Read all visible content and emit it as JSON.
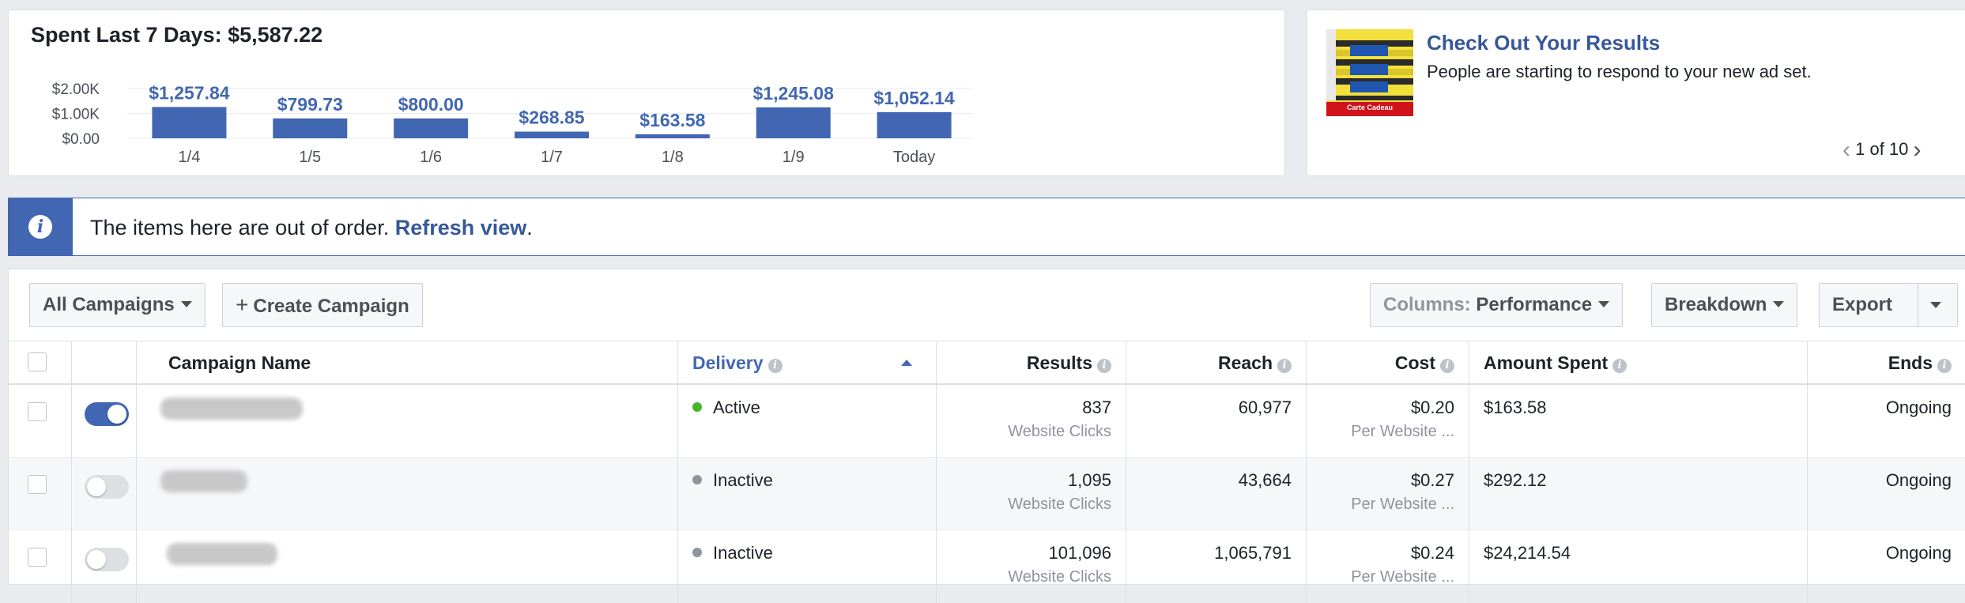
{
  "spend_card": {
    "title": "Spent Last 7 Days: $5,587.22"
  },
  "chart_data": {
    "type": "bar",
    "title": "Spent Last 7 Days: $5,587.22",
    "categories": [
      "1/4",
      "1/5",
      "1/6",
      "1/7",
      "1/8",
      "1/9",
      "Today"
    ],
    "values": [
      1257.84,
      799.73,
      800.0,
      268.85,
      163.58,
      1245.08,
      1052.14
    ],
    "value_labels": [
      "$1,257.84",
      "$799.73",
      "$800.00",
      "$268.85",
      "$163.58",
      "$1,245.08",
      "$1,052.14"
    ],
    "y_ticks": [
      "$2.00K",
      "$1.00K",
      "$0.00"
    ],
    "y_tick_values": [
      2000,
      1000,
      0
    ],
    "ylim": [
      0,
      2000
    ],
    "grid": true,
    "bar_color": "#4267b2",
    "label_color": "#4267b2"
  },
  "results_card": {
    "title": "Check Out Your Results",
    "text": "People are starting to respond to your new ad set.",
    "pager": "1 of 10",
    "thumb_caption": "Carte Cadeau"
  },
  "info_banner": {
    "text": "The items here are out of order.",
    "link": "Refresh view",
    "trailing": "."
  },
  "toolbar": {
    "all_campaigns": "All Campaigns",
    "create_campaign": "Create Campaign",
    "columns_prefix": "Columns:",
    "columns_value": "Performance",
    "breakdown": "Breakdown",
    "export": "Export"
  },
  "table": {
    "headers": {
      "name": "Campaign Name",
      "delivery": "Delivery",
      "results": "Results",
      "reach": "Reach",
      "cost": "Cost",
      "amount_spent": "Amount Spent",
      "ends": "Ends"
    },
    "rows": [
      {
        "toggle": "on",
        "delivery": "Active",
        "results": "837",
        "results_sub": "Website Clicks",
        "reach": "60,977",
        "cost": "$0.20",
        "cost_sub": "Per Website ...",
        "amount": "$163.58",
        "ends": "Ongoing"
      },
      {
        "toggle": "off",
        "delivery": "Inactive",
        "results": "1,095",
        "results_sub": "Website Clicks",
        "reach": "43,664",
        "cost": "$0.27",
        "cost_sub": "Per Website ...",
        "amount": "$292.12",
        "ends": "Ongoing"
      },
      {
        "toggle": "off",
        "delivery": "Inactive",
        "results": "101,096",
        "results_sub": "Website Clicks",
        "reach": "1,065,791",
        "cost": "$0.24",
        "cost_sub": "Per Website ...",
        "amount": "$24,214.54",
        "ends": "Ongoing"
      }
    ]
  },
  "colors": {
    "accent": "#4267b2",
    "link": "#365899",
    "active": "#42b72a",
    "inactive": "#90949c"
  }
}
